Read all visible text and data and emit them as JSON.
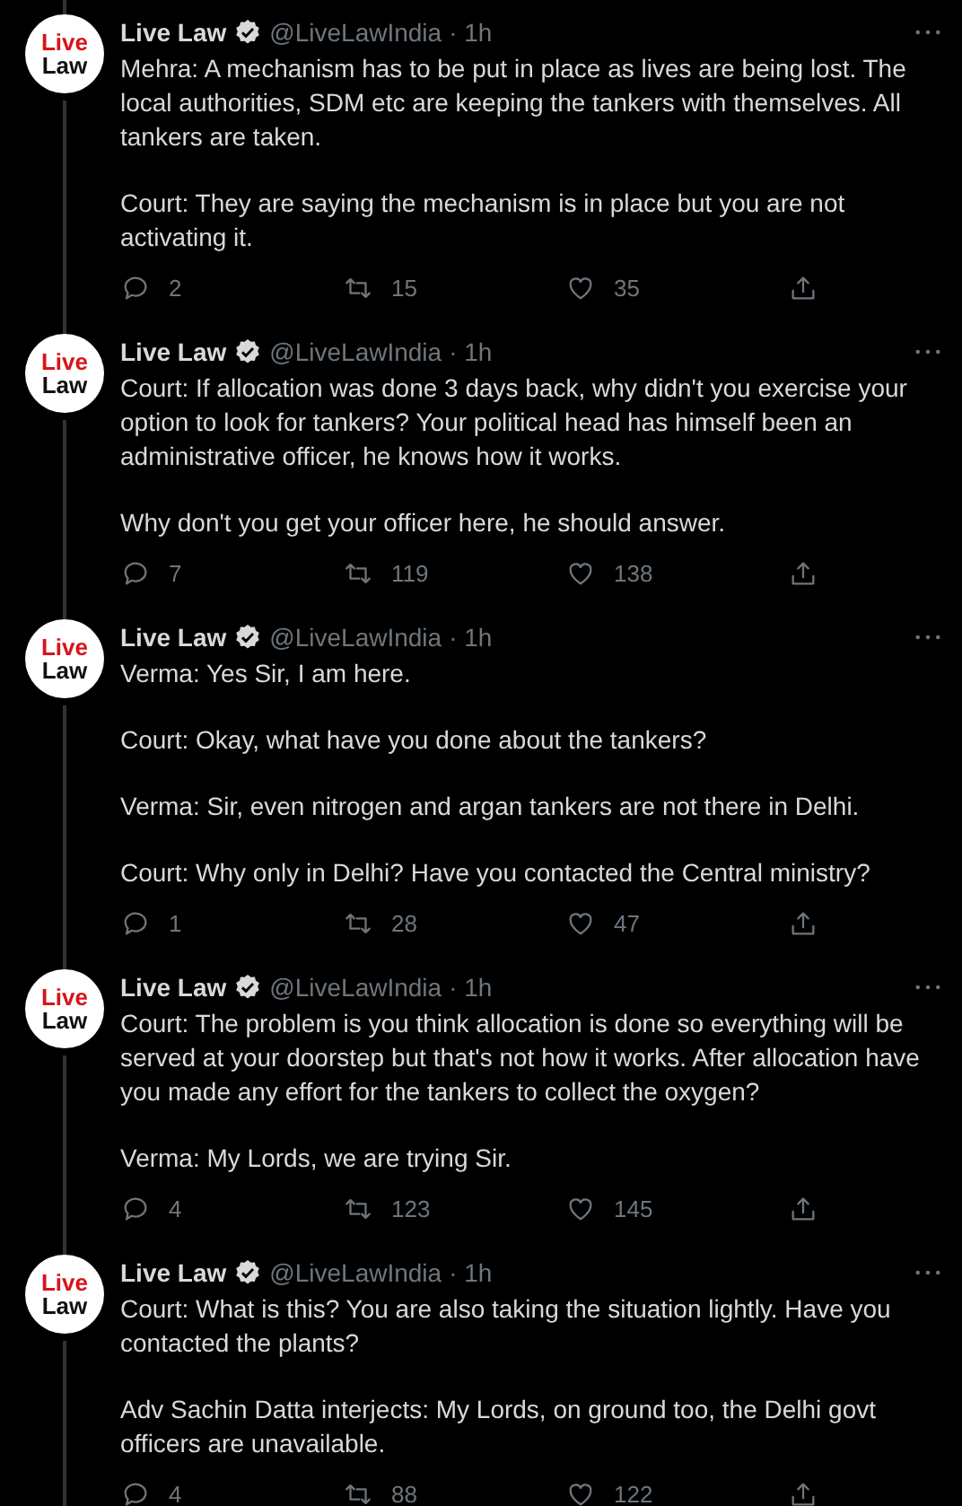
{
  "tweets": [
    {
      "avatar": {
        "top": "Live",
        "bottom": "Law"
      },
      "author": "Live Law",
      "handle": "@LiveLawIndia",
      "time": "· 1h",
      "paragraphs": [
        "Mehra: A mechanism has to be put in place as lives are being lost. The local authorities, SDM etc are keeping the tankers with themselves. All tankers are taken.",
        "Court: They are saying the mechanism is in place but you are not activating it."
      ],
      "replies": "2",
      "retweets": "15",
      "likes": "35"
    },
    {
      "avatar": {
        "top": "Live",
        "bottom": "Law"
      },
      "author": "Live Law",
      "handle": "@LiveLawIndia",
      "time": "· 1h",
      "paragraphs": [
        "Court: If allocation was done 3 days back, why didn't you exercise your option to look for tankers? Your political head has himself been an administrative officer, he knows how it works.",
        "Why don't you get your officer here, he should answer."
      ],
      "replies": "7",
      "retweets": "119",
      "likes": "138"
    },
    {
      "avatar": {
        "top": "Live",
        "bottom": "Law"
      },
      "author": "Live Law",
      "handle": "@LiveLawIndia",
      "time": "· 1h",
      "paragraphs": [
        "Verma: Yes Sir, I am here.",
        "Court: Okay, what have you done about the tankers?",
        "Verma: Sir, even nitrogen and argan tankers are not there in Delhi.",
        "Court: Why only in Delhi? Have you contacted the Central ministry?"
      ],
      "replies": "1",
      "retweets": "28",
      "likes": "47"
    },
    {
      "avatar": {
        "top": "Live",
        "bottom": "Law"
      },
      "author": "Live Law",
      "handle": "@LiveLawIndia",
      "time": "· 1h",
      "paragraphs": [
        "Court: The problem is you think allocation is done so everything will be served at your doorstep but that's not how it works. After allocation have you made any effort for the tankers to collect the oxygen?",
        "Verma: My Lords, we are trying Sir."
      ],
      "replies": "4",
      "retweets": "123",
      "likes": "145"
    },
    {
      "avatar": {
        "top": "Live",
        "bottom": "Law"
      },
      "author": "Live Law",
      "handle": "@LiveLawIndia",
      "time": "· 1h",
      "paragraphs": [
        "Court: What is this? You are also taking the situation lightly. Have you contacted the plants?",
        "Adv Sachin Datta interjects: My Lords, on ground too, the Delhi govt officers are unavailable."
      ],
      "replies": "4",
      "retweets": "88",
      "likes": "122"
    }
  ]
}
